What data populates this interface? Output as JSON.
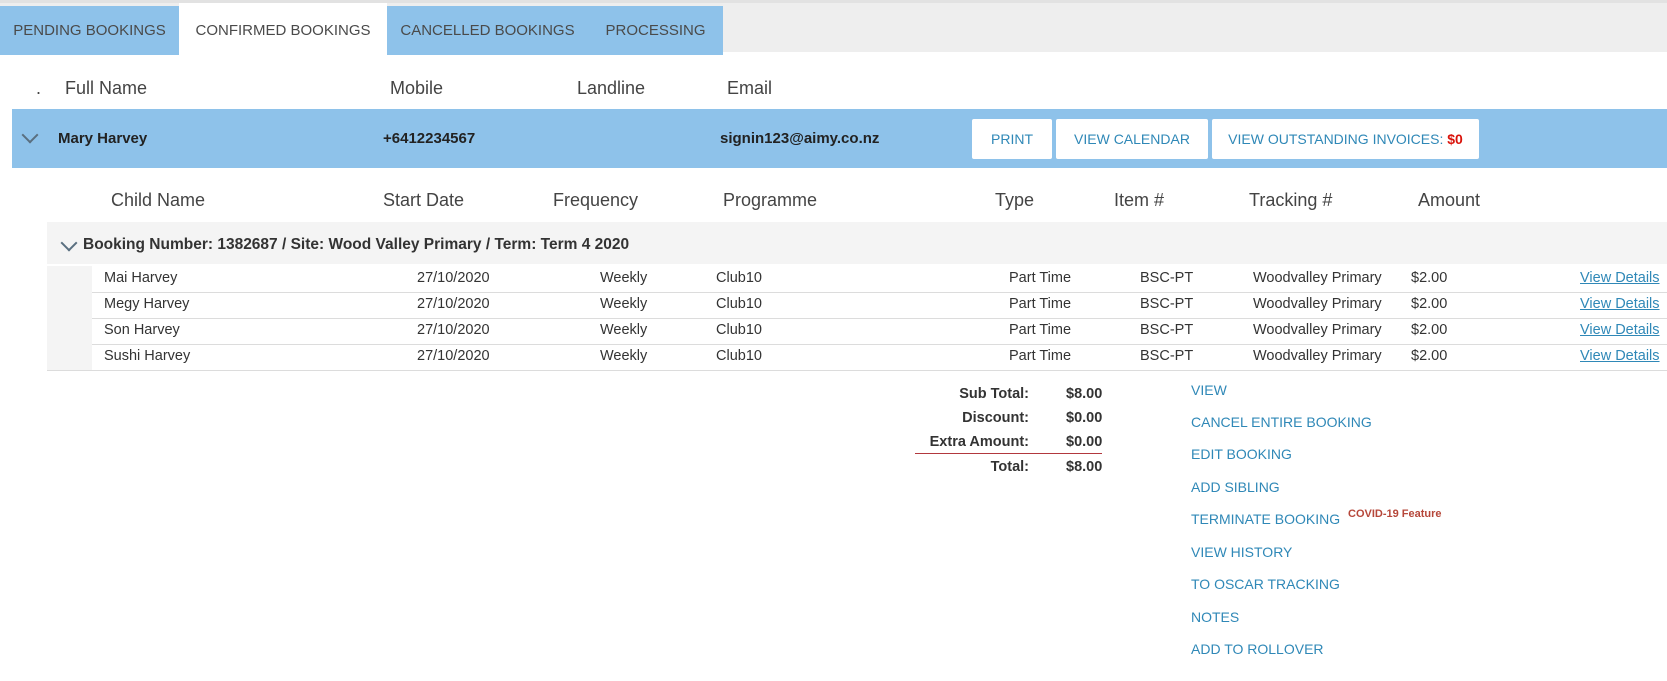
{
  "tabs": [
    {
      "label": "PENDING BOOKINGS",
      "active": false
    },
    {
      "label": "CONFIRMED BOOKINGS",
      "active": true
    },
    {
      "label": "CANCELLED BOOKINGS",
      "active": false
    },
    {
      "label": "PROCESSING",
      "active": false
    }
  ],
  "parent_headers": {
    "dot": ".",
    "full_name": "Full Name",
    "mobile": "Mobile",
    "landline": "Landline",
    "email": "Email"
  },
  "parent": {
    "name": "Mary Harvey",
    "mobile": "+6412234567",
    "landline": "",
    "email": "signin123@aimy.co.nz",
    "buttons": {
      "print": "PRINT",
      "view_calendar": "VIEW CALENDAR",
      "outstanding_label": "VIEW OUTSTANDING INVOICES:",
      "outstanding_amount": "$0"
    }
  },
  "child_headers": {
    "child_name": "Child Name",
    "start_date": "Start Date",
    "frequency": "Frequency",
    "programme": "Programme",
    "type": "Type",
    "item": "Item #",
    "tracking": "Tracking #",
    "amount": "Amount"
  },
  "booking": {
    "title": "Booking Number: 1382687 / Site: Wood Valley Primary / Term: Term 4 2020"
  },
  "rows": [
    {
      "child": "Mai Harvey",
      "start": "27/10/2020",
      "freq": "Weekly",
      "prog": "Club10",
      "type": "Part Time",
      "item": "BSC-PT",
      "tracking": "Woodvalley Primary",
      "amount": "$2.00",
      "link": "View Details"
    },
    {
      "child": "Megy Harvey",
      "start": "27/10/2020",
      "freq": "Weekly",
      "prog": "Club10",
      "type": "Part Time",
      "item": "BSC-PT",
      "tracking": "Woodvalley Primary",
      "amount": "$2.00",
      "link": "View Details"
    },
    {
      "child": "Son Harvey",
      "start": "27/10/2020",
      "freq": "Weekly",
      "prog": "Club10",
      "type": "Part Time",
      "item": "BSC-PT",
      "tracking": "Woodvalley Primary",
      "amount": "$2.00",
      "link": "View Details"
    },
    {
      "child": "Sushi Harvey",
      "start": "27/10/2020",
      "freq": "Weekly",
      "prog": "Club10",
      "type": "Part Time",
      "item": "BSC-PT",
      "tracking": "Woodvalley Primary",
      "amount": "$2.00",
      "link": "View Details"
    }
  ],
  "totals": {
    "sub_total_label": "Sub Total:",
    "sub_total": "$8.00",
    "discount_label": "Discount:",
    "discount": "$0.00",
    "extra_label": "Extra Amount:",
    "extra": "$0.00",
    "total_label": "Total:",
    "total": "$8.00"
  },
  "actions": {
    "view": "VIEW",
    "cancel": "CANCEL ENTIRE BOOKING",
    "edit": "EDIT BOOKING",
    "add_sibling": "ADD SIBLING",
    "terminate": "TERMINATE BOOKING",
    "covid_note": "COVID-19 Feature",
    "history": "VIEW HISTORY",
    "oscar": "TO OSCAR TRACKING",
    "notes": "NOTES",
    "rollover": "ADD TO ROLLOVER"
  },
  "colors": {
    "tab_blue": "#8ec2ea",
    "link": "#2f88b7",
    "red_amount": "#d9130a",
    "total_rule": "#b2383e",
    "covid_note": "#b6473a"
  }
}
